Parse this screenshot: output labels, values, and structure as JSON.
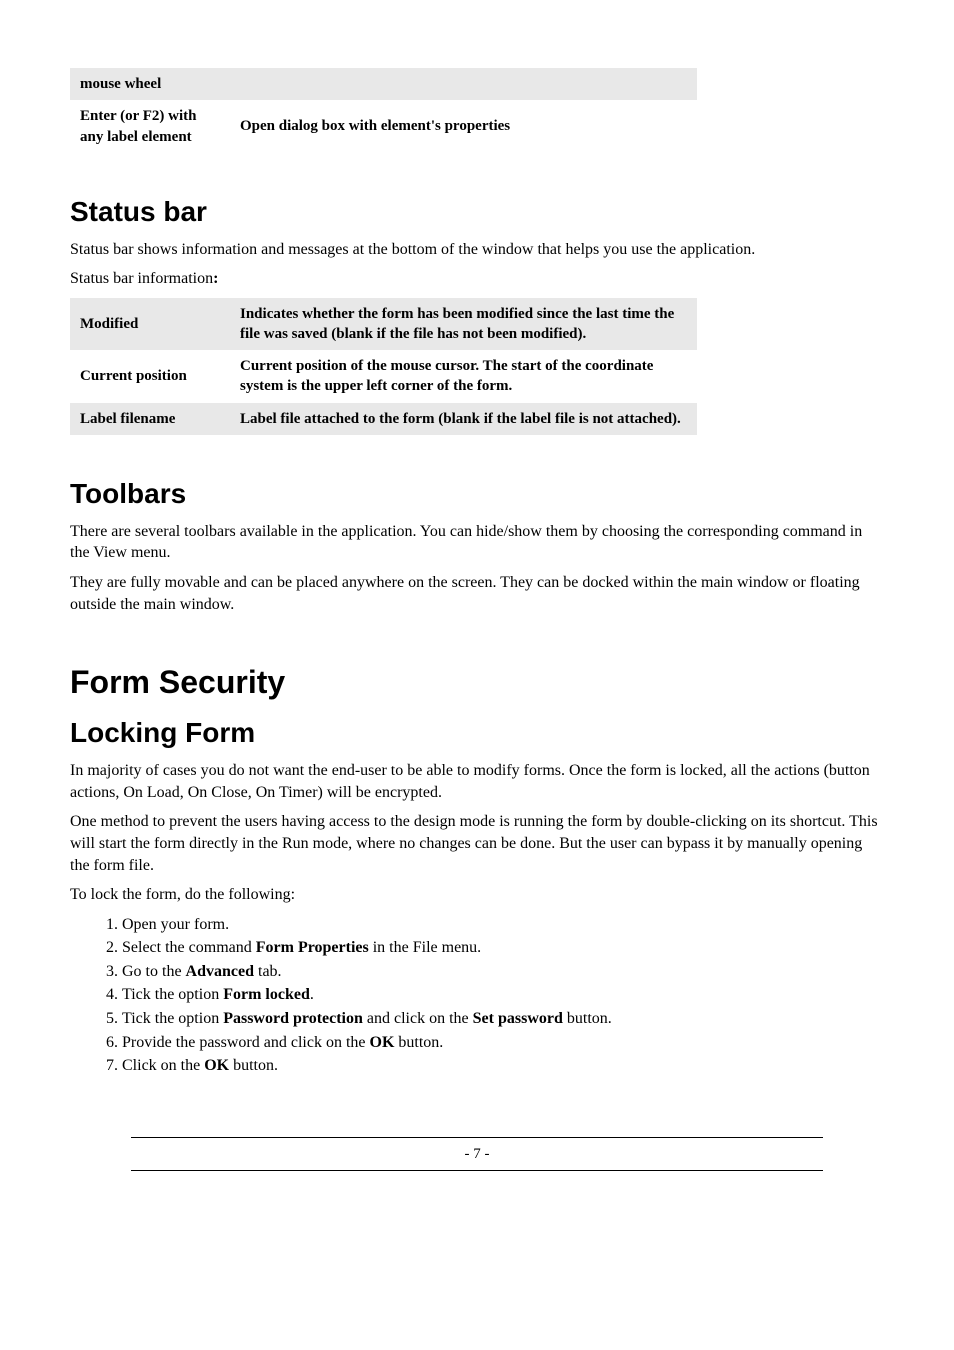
{
  "topTable": {
    "r1c1": "mouse wheel",
    "r1c2": "",
    "r2c1": "Enter (or F2) with any label element",
    "r2c2": "Open dialog box with element's properties"
  },
  "statusBar": {
    "heading": "Status bar",
    "intro": "Status bar shows information and messages at the bottom of the window that helps you use the application.",
    "label": "Status bar information",
    "colon": ":",
    "rows": {
      "r1c1": "Modified",
      "r1c2": "Indicates whether the form has been modified since the last time the file was saved (blank if the file has not been modified).",
      "r2c1": "Current position",
      "r2c2": "Current position of the mouse cursor. The start of the coordinate system is the upper left corner of the form.",
      "r3c1": "Label filename",
      "r3c2": "Label file attached to the form (blank if the label file is not attached)."
    }
  },
  "toolbars": {
    "heading": "Toolbars",
    "p1": "There are several toolbars available in the application. You can hide/show them by choosing the corresponding command in the View menu.",
    "p2": "They are fully movable and can be placed anywhere on the screen. They can be docked within the main window or floating outside the main window."
  },
  "formSecurity": {
    "heading": "Form Security",
    "locking": {
      "heading": "Locking Form",
      "p1": "In majority of cases you do not want the end-user to be able to modify forms. Once the form is locked, all the actions (button actions, On Load, On Close, On Timer) will be encrypted.",
      "p2": "One method to prevent the users having access to the design mode is running the form by double-clicking on its shortcut. This will start the form directly in the Run mode, where no changes can be done. But the user can bypass it by manually opening the form file.",
      "p3": "To lock the form, do the following:",
      "steps": {
        "s1": "Open your form.",
        "s2a": "Select the command ",
        "s2b": "Form Properties",
        "s2c": " in the File menu.",
        "s3a": "Go to the ",
        "s3b": "Advanced",
        "s3c": " tab.",
        "s4a": "Tick the option ",
        "s4b": "Form locked",
        "s4c": ".",
        "s5a": "Tick the option ",
        "s5b": "Password protection",
        "s5c": " and click on the ",
        "s5d": "Set password",
        "s5e": " button.",
        "s6a": "Provide the password and click on the ",
        "s6b": "OK",
        "s6c": " button.",
        "s7a": "Click on the ",
        "s7b": "OK",
        "s7c": " button."
      }
    }
  },
  "footer": "- 7 -"
}
